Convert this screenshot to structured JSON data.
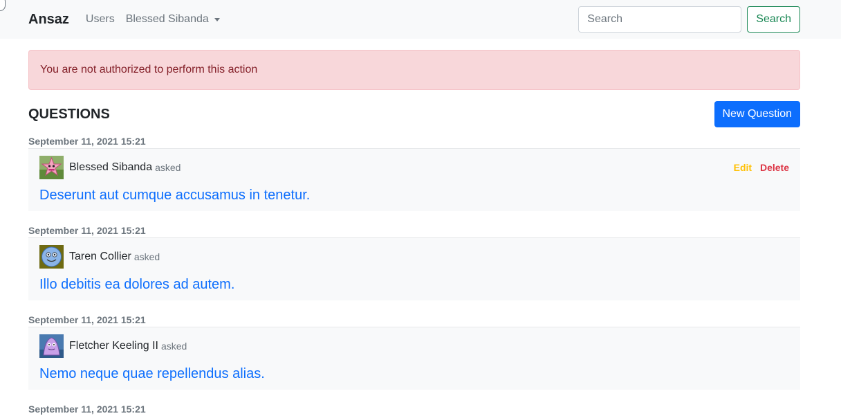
{
  "navbar": {
    "brand": "Ansaz",
    "links": [
      "Users",
      "Blessed Sibanda"
    ],
    "search_placeholder": "Search",
    "search_button": "Search"
  },
  "alert": {
    "message": "You are not authorized to perform this action"
  },
  "questions": {
    "heading": "QUESTIONS",
    "new_button": "New Question",
    "asked_label": "asked",
    "edit_label": "Edit",
    "delete_label": "Delete",
    "items": [
      {
        "date": "September 11, 2021 15:21",
        "author": "Blessed Sibanda",
        "title": "Deserunt aut cumque accusamus in tenetur.",
        "avatar_icon": "pink-star-avatar-icon"
      },
      {
        "date": "September 11, 2021 15:21",
        "author": "Taren Collier",
        "title": "Illo debitis ea dolores ad autem.",
        "avatar_icon": "blue-face-avatar-icon"
      },
      {
        "date": "September 11, 2021 15:21",
        "author": "Fletcher Keeling II",
        "title": "Nemo neque quae repellendus alias.",
        "avatar_icon": "purple-blob-avatar-icon"
      },
      {
        "date": "September 11, 2021 15:21"
      }
    ]
  },
  "colors": {
    "primary": "#0d6efd",
    "success": "#198754",
    "warning": "#ffc107",
    "danger": "#dc3545",
    "alert_bg": "#f8d7da"
  }
}
